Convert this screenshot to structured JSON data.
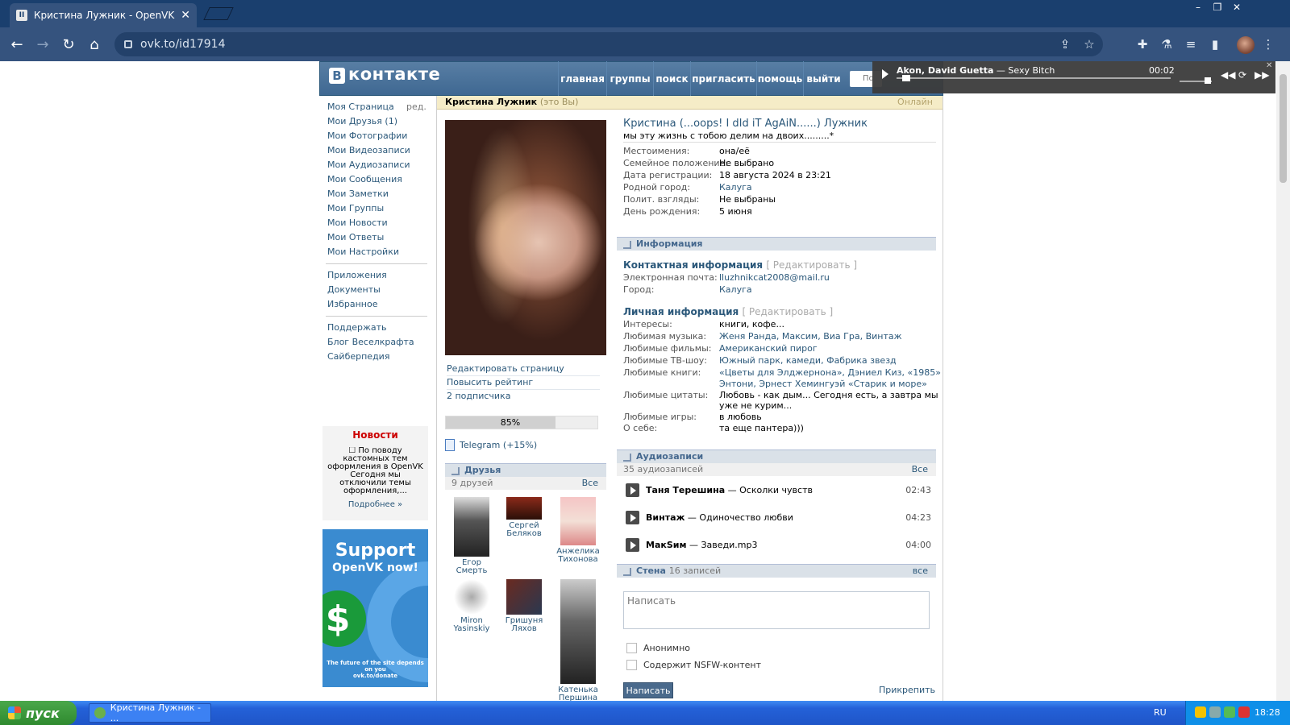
{
  "browser": {
    "tab_title": "Кристина Лужник - OpenVK",
    "url": "ovk.to/id17914"
  },
  "vk": {
    "logo_text": "контакте",
    "logo_letter": "B",
    "nav": [
      "главная",
      "группы",
      "поиск",
      "пригласить",
      "помощь",
      "выйти"
    ],
    "search_placeholder": "По"
  },
  "player": {
    "artist": "Akon, David Guetta",
    "title": " — Sexy Bitch",
    "time": "00:02",
    "progress": 0.02
  },
  "left_menu": {
    "edit": "ред.",
    "group1": [
      "Моя Страница",
      "Мои Друзья (1)",
      "Мои Фотографии",
      "Мои Видеозаписи",
      "Мои Аудиозаписи",
      "Мои Сообщения",
      "Мои Заметки",
      "Мои Группы",
      "Мои Новости",
      "Мои Ответы",
      "Мои Настройки"
    ],
    "group2": [
      "Приложения",
      "Документы",
      "Избранное"
    ],
    "group3": [
      "Поддержать",
      "Блог Веселкрафта",
      "Сайберпедия"
    ]
  },
  "news": {
    "heading": "Новости",
    "text": "☐ По поводу кастомных тем оформления в OpenVK Сегодня мы отключили темы оформления,...",
    "more": "Подробнее »"
  },
  "banner": {
    "line1": "Support",
    "line2": "OpenVK now!",
    "dollar": "$",
    "footer1": "The future of the site depends on you",
    "footer2": "ovk.to/donate"
  },
  "topbar": {
    "name": "Кристина Лужник",
    "you": "(это Вы)",
    "online": "Онлайн"
  },
  "profile_links": [
    "Редактировать страницу",
    "Повысить рейтинг",
    "2 подписчика"
  ],
  "rating": {
    "label": "85%",
    "value": 0.85
  },
  "telegram": "Telegram (+15%)",
  "friends": {
    "heading": "Друзья",
    "count": "9 друзей",
    "all": "Все",
    "items": [
      {
        "first": "Егор",
        "last": "Смерть"
      },
      {
        "first": "Сергей",
        "last": "Беляков"
      },
      {
        "first": "Анжелика",
        "last": "Тихонова"
      },
      {
        "first": "Miron",
        "last": "Yasinskiy"
      },
      {
        "first": "Гришуня",
        "last": "Ляхов"
      },
      {
        "first": "Катенька",
        "last": "Першина"
      }
    ]
  },
  "profile": {
    "name": "Кристина (...oops! I dId iT AgAiN......) Лужник",
    "status": "мы эту жизнь с тобою делим на двоих.........*",
    "fields": [
      {
        "k": "Местоимения:",
        "v": "она/её"
      },
      {
        "k": "Семейное положение:",
        "v": "Не выбрано"
      },
      {
        "k": "Дата регистрации:",
        "v": "18 августа 2024 в 23:21"
      },
      {
        "k": "Родной город:",
        "v": "Калуга"
      },
      {
        "k": "Полит. взгляды:",
        "v": "Не выбраны"
      },
      {
        "k": "День рождения:",
        "v": "5 июня"
      }
    ]
  },
  "info": {
    "heading": "Информация",
    "contact_title": "Контактная информация",
    "edit": "[ Редактировать ]",
    "email_k": "Электронная почта:",
    "email_v": "lluzhnikcat2008@mail.ru",
    "city_k": "Город:",
    "city_v": "Калуга",
    "personal_title": "Личная информация",
    "interests_k": "Интересы:",
    "interests_v": "книги, кофе...",
    "music_k": "Любимая музыка:",
    "music_v": [
      "Женя Ранда",
      "Максим",
      "Виа Гра",
      "Винтаж"
    ],
    "films_k": "Любимые фильмы:",
    "films_v": "Американский пирог",
    "tv_k": "Любимые ТВ-шоу:",
    "tv_v": [
      "Южный парк",
      "камеди",
      "Фабрика звезд"
    ],
    "books_k": "Любимые книги:",
    "books_v1": "«Цветы для Элджернона», Дэниел Киз, «1985»",
    "books_v2": "Энтони, Эрнест Хемингуэй «Старик и море»",
    "quotes_k": "Любимые цитаты:",
    "quotes_v1": "Любовь - как дым... Сегодня есть, а завтра мы",
    "quotes_v2": "уже не курим...",
    "games_k": "Любимые игры:",
    "games_v": "в любовь",
    "about_k": "О себе:",
    "about_v": "та еще пантера)))"
  },
  "audio": {
    "heading": "Аудиозаписи",
    "count": "35 аудиозаписей",
    "all": "Все",
    "items": [
      {
        "artist": "Таня Терешина",
        "title": " — Осколки чувств",
        "dur": "02:43"
      },
      {
        "artist": "Винтаж",
        "title": " — Одиночество любви",
        "dur": "04:23"
      },
      {
        "artist": "МакSим",
        "title": " — Заведи.mp3",
        "dur": "04:00"
      }
    ]
  },
  "wall": {
    "heading": "Стена",
    "count": "16 записей",
    "all": "все",
    "placeholder": "Написать",
    "anon": "Анонимно",
    "nsfw": "Содержит NSFW-контент",
    "post": "Написать",
    "attach": "Прикрепить"
  },
  "taskbar": {
    "start": "пуск",
    "task": "Кристина Лужник - ...",
    "lang": "RU",
    "clock": "18:28"
  },
  "colors": {
    "vk_blue": "#45688e",
    "link": "#2b587a",
    "chrome_dark": "#1a3f6e"
  }
}
